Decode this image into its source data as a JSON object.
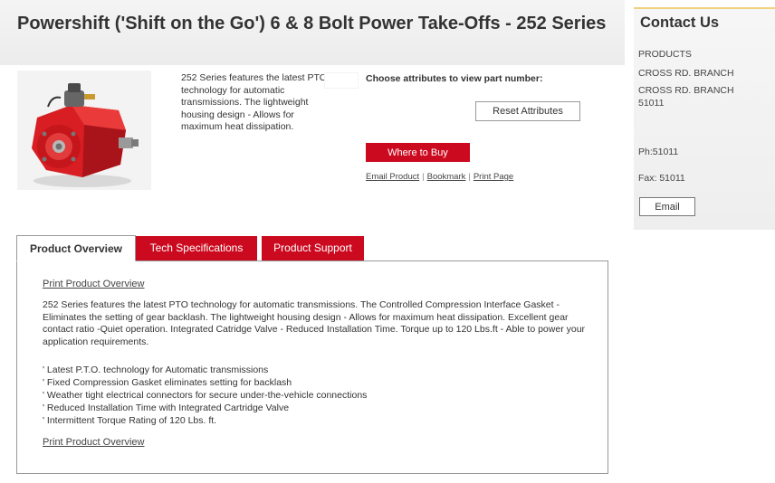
{
  "product": {
    "title": "Powershift ('Shift on the Go') 6 & 8 Bolt Power Take-Offs - 252 Series",
    "blurb": "252 Series features the latest PTO technology for automatic transmissions. The lightweight housing design - Allows for maximum heat dissipation.",
    "choose_label": "Choose attributes to view part number:",
    "reset_label": "Reset Attributes",
    "where_label": "Where to Buy",
    "links": [
      "Email Product",
      "Bookmark",
      "Print Page"
    ],
    "colors": {
      "brand_red": "#cc0a1f",
      "product_red": "#d81e22"
    }
  },
  "contact": {
    "title": "Contact Us",
    "lines": [
      "PRODUCTS",
      "CROSS RD. BRANCH",
      "CROSS RD. BRANCH",
      "51011",
      "Ph:51011",
      "Fax: 51011"
    ],
    "email_label": "Email"
  },
  "tabs": [
    {
      "label": "Product Overview"
    },
    {
      "label": "Tech Specifications"
    },
    {
      "label": "Product Support"
    }
  ],
  "overview": {
    "print_label": "Print Product Overview",
    "text": "252 Series features the latest PTO technology for automatic transmissions. The Controlled Compression Interface Gasket - Eliminates the setting of gear backlash. The lightweight housing design - Allows for maximum heat dissipation. Excellent gear contact ratio -Quiet operation. Integrated Catridge Valve - Reduced Installation Time. Torque up to 120 Lbs.ft - Able to power your application requirements.",
    "features": [
      "' Latest P.T.O. technology for Automatic transmissions",
      "' Fixed Compression Gasket eliminates setting for backlash",
      "' Weather tight electrical connectors for secure under-the-vehicle connections",
      "' Reduced Installation Time with Integrated Cartridge Valve",
      "' Intermittent Torque Rating of 120 Lbs. ft."
    ]
  }
}
